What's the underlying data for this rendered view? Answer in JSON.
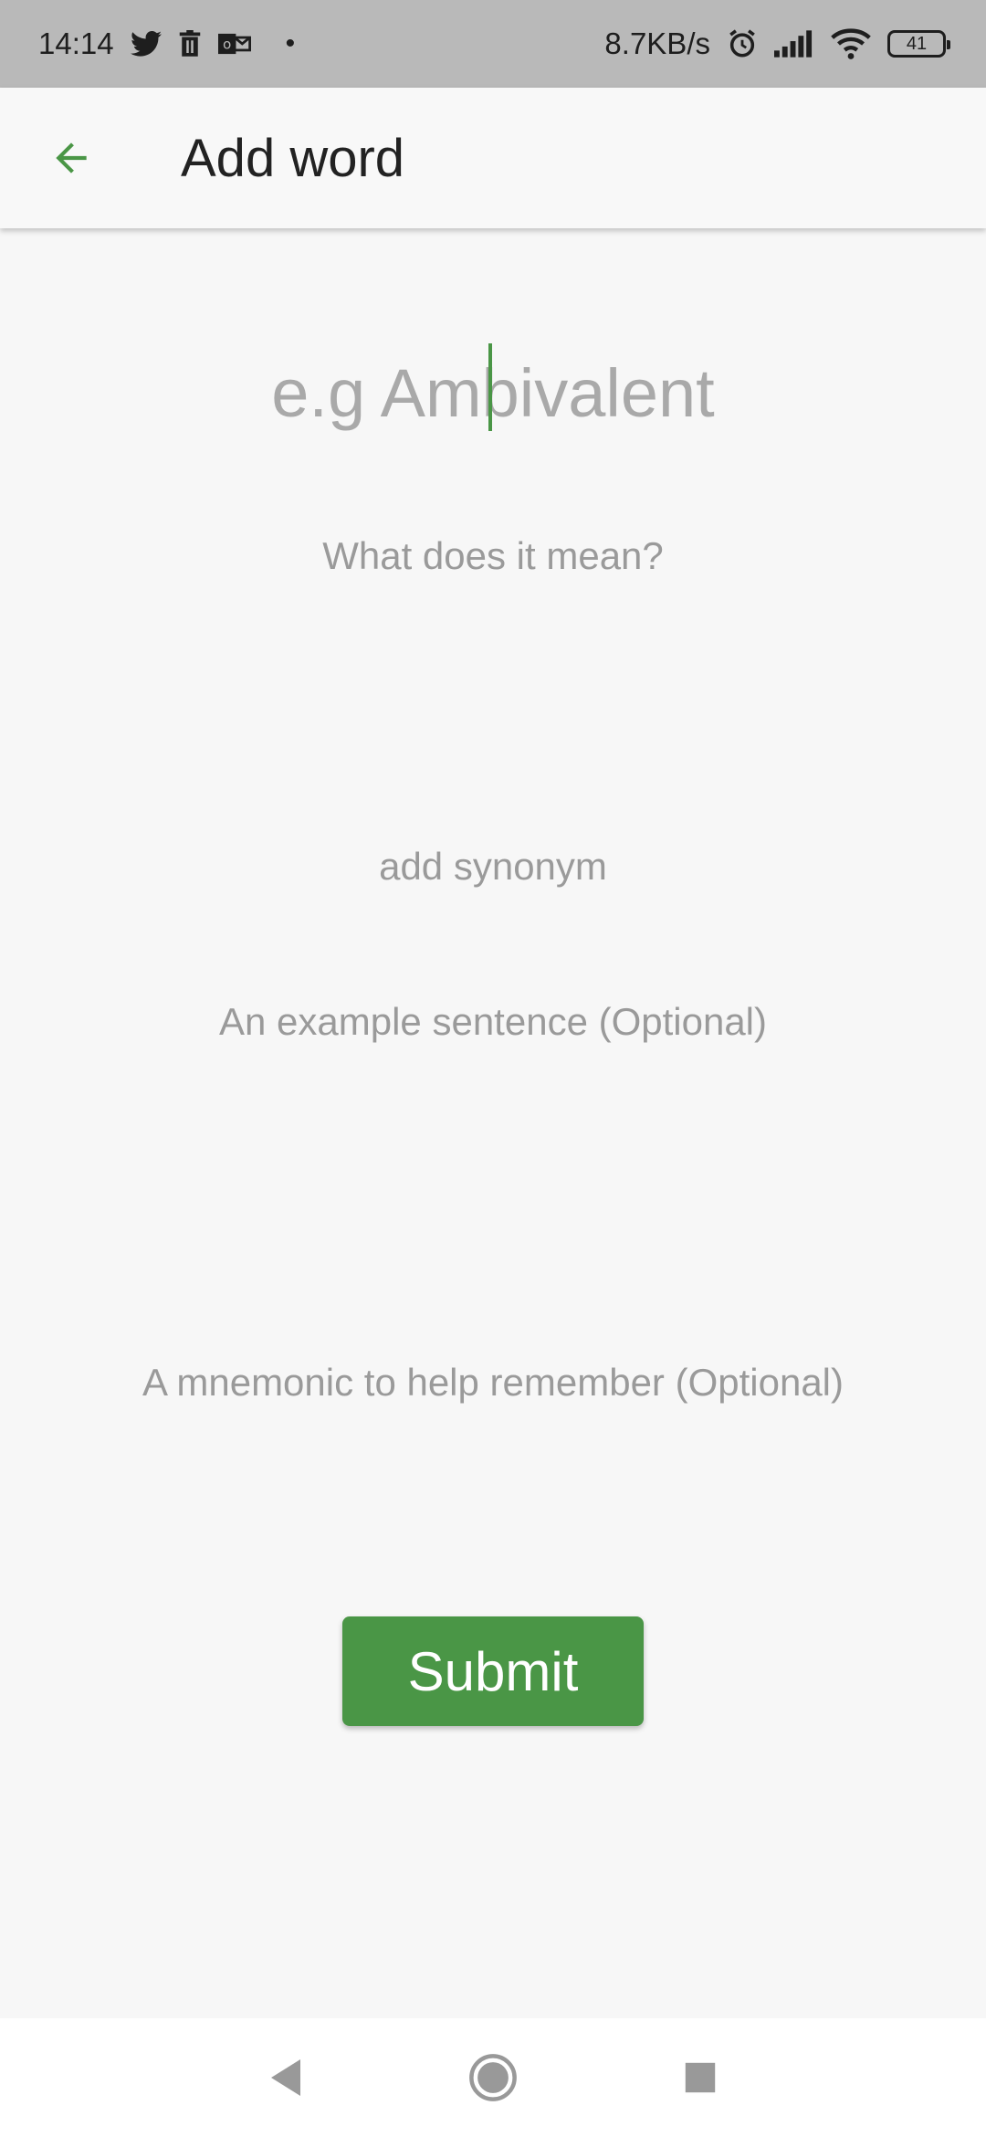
{
  "status_bar": {
    "time": "14:14",
    "net_speed": "8.7KB/s",
    "battery": "41",
    "icons": [
      "twitter-icon",
      "trash-icon",
      "outlook-icon",
      "dot",
      "alarm-icon",
      "signal-icon",
      "wifi-icon",
      "battery-icon"
    ]
  },
  "app_bar": {
    "title": "Add word",
    "back_icon": "arrow-back-icon"
  },
  "form": {
    "word_placeholder": "e.g Ambivalent",
    "meaning_placeholder": "What does it mean?",
    "synonym_placeholder": "add synonym",
    "example_placeholder": "An example sentence  (Optional)",
    "mnemonic_placeholder": "A mnemonic to help remember  (Optional)",
    "submit_label": "Submit"
  },
  "nav_bar": {
    "icons": [
      "back-triangle-icon",
      "home-circle-icon",
      "recents-square-icon"
    ]
  },
  "colors": {
    "accent": "#4a9646",
    "status_bar_bg": "#b9b9b9",
    "background": "#f7f7f7",
    "placeholder": "#9a9a9a"
  }
}
